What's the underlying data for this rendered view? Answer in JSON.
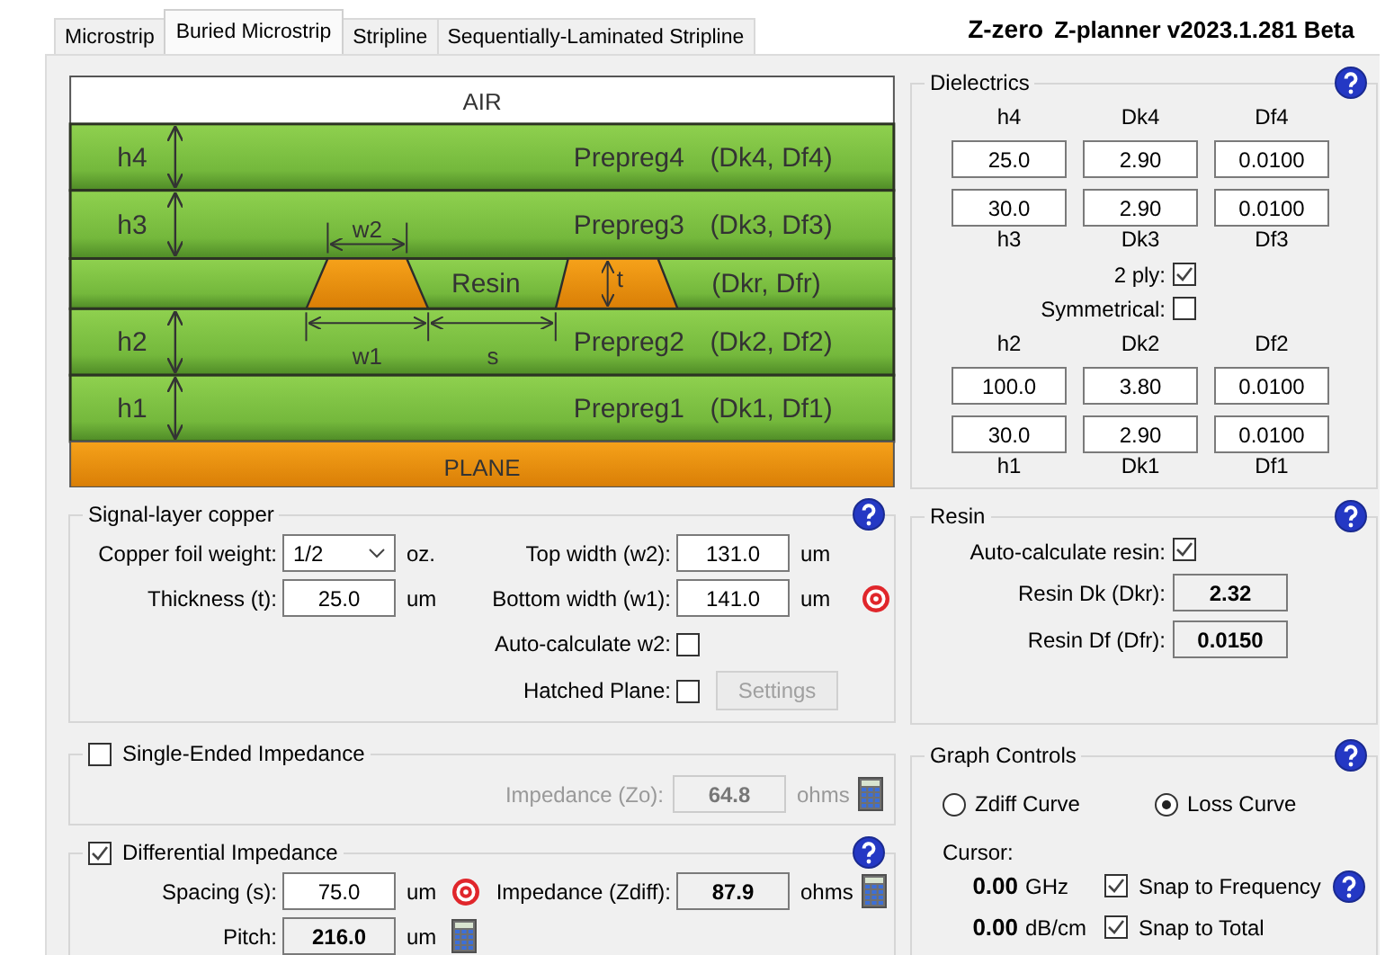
{
  "tabs": [
    {
      "label": "Microstrip",
      "selected": false
    },
    {
      "label": "Buried Microstrip",
      "selected": true
    },
    {
      "label": "Stripline",
      "selected": false
    },
    {
      "label": "Sequentially-Laminated Stripline",
      "selected": false
    }
  ],
  "app_title": {
    "brand": "Z-zero",
    "product": "Z-planner v2023.1.281 Beta"
  },
  "stackup": {
    "air": "AIR",
    "layers": [
      {
        "kind": "prepreg",
        "height": "h4",
        "name": "Prepreg4",
        "params": "(Dk4, Df4)"
      },
      {
        "kind": "prepreg",
        "height": "h3",
        "name": "Prepreg3",
        "params": "(Dk3, Df3)"
      },
      {
        "kind": "resin",
        "name": "Resin",
        "params": "(Dkr, Dfr)"
      },
      {
        "kind": "prepreg",
        "height": "h2",
        "name": "Prepreg2",
        "params": "(Dk2, Df2)"
      },
      {
        "kind": "prepreg",
        "height": "h1",
        "name": "Prepreg1",
        "params": "(Dk1, Df1)"
      }
    ],
    "plane": "PLANE",
    "dimensions": {
      "top_width": "w2",
      "bottom_width": "w1",
      "spacing": "s",
      "thickness": "t"
    }
  },
  "dielectrics": {
    "title": "Dielectrics",
    "upper": {
      "headers": [
        "h4",
        "Dk4",
        "Df4"
      ],
      "rows": [
        [
          "25.0",
          "2.90",
          "0.0100"
        ],
        [
          "30.0",
          "2.90",
          "0.0100"
        ]
      ],
      "footers": [
        "h3",
        "Dk3",
        "Df3"
      ]
    },
    "options": [
      {
        "label": "2 ply:",
        "checked": true
      },
      {
        "label": "Symmetrical:",
        "checked": false
      }
    ],
    "lower": {
      "headers": [
        "h2",
        "Dk2",
        "Df2"
      ],
      "rows": [
        [
          "100.0",
          "3.80",
          "0.0100"
        ],
        [
          "30.0",
          "2.90",
          "0.0100"
        ]
      ],
      "footers": [
        "h1",
        "Dk1",
        "Df1"
      ]
    }
  },
  "signal_copper": {
    "title": "Signal-layer copper",
    "foil_weight": {
      "label": "Copper foil weight:",
      "value": "1/2",
      "unit": "oz."
    },
    "thickness": {
      "label": "Thickness (t):",
      "value": "25.0",
      "unit": "um"
    },
    "top_width": {
      "label": "Top width (w2):",
      "value": "131.0",
      "unit": "um"
    },
    "bottom_width": {
      "label": "Bottom width (w1):",
      "value": "141.0",
      "unit": "um"
    },
    "auto_w2": {
      "label": "Auto-calculate w2:",
      "checked": false
    },
    "hatched_plane": {
      "label": "Hatched Plane:",
      "checked": false
    },
    "settings_button": {
      "label": "Settings",
      "disabled": true
    }
  },
  "resin": {
    "title": "Resin",
    "auto": {
      "label": "Auto-calculate resin:",
      "checked": true
    },
    "dk": {
      "label": "Resin Dk (Dkr):",
      "value": "2.32"
    },
    "df": {
      "label": "Resin Df (Dfr):",
      "value": "0.0150"
    }
  },
  "single_ended": {
    "title": "Single-Ended Impedance",
    "checked": false,
    "impedance": {
      "label": "Impedance (Zo):",
      "value": "64.8",
      "unit": "ohms"
    }
  },
  "differential": {
    "title": "Differential Impedance",
    "checked": true,
    "spacing": {
      "label": "Spacing (s):",
      "value": "75.0",
      "unit": "um"
    },
    "impedance": {
      "label": "Impedance (Zdiff):",
      "value": "87.9",
      "unit": "ohms"
    },
    "pitch": {
      "label": "Pitch:",
      "value": "216.0",
      "unit": "um"
    }
  },
  "graph_controls": {
    "title": "Graph Controls",
    "curves": [
      {
        "label": "Zdiff Curve",
        "selected": false
      },
      {
        "label": "Loss Curve",
        "selected": true
      }
    ],
    "cursor_label": "Cursor:",
    "cursors": [
      {
        "value": "0.00",
        "unit": "GHz",
        "snap_label": "Snap to Frequency",
        "checked": true
      },
      {
        "value": "0.00",
        "unit": "dB/cm",
        "snap_label": "Snap to Total",
        "checked": true
      }
    ]
  }
}
